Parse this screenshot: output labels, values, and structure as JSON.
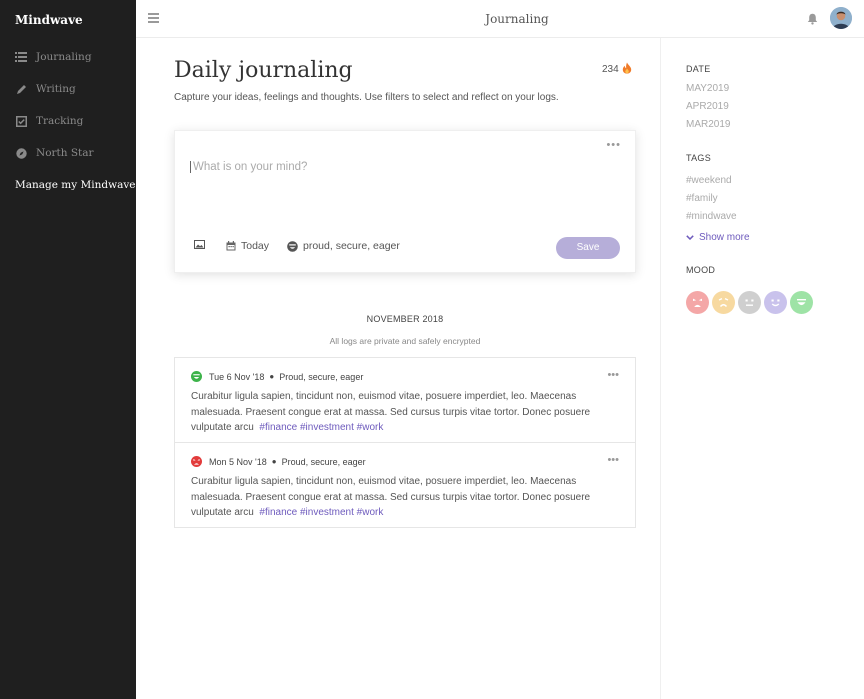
{
  "app": {
    "brand": "Mindwave",
    "window_title": "Journaling"
  },
  "sidebar": {
    "items": [
      {
        "label": "Journaling",
        "icon": "list-icon"
      },
      {
        "label": "Writing",
        "icon": "pen-icon"
      },
      {
        "label": "Tracking",
        "icon": "checkbox-icon"
      },
      {
        "label": "North Star",
        "icon": "compass-icon"
      }
    ],
    "manage_label": "Manage my Mindwave"
  },
  "header": {
    "title": "Daily journaling",
    "subtitle": "Capture your ideas, feelings and thoughts. Use filters to select and reflect on your logs.",
    "streak_count": "234",
    "streak_icon": "fire-icon"
  },
  "composer": {
    "placeholder": "What is on your mind?",
    "date_label": "Today",
    "mood_label": "proud, secure, eager",
    "save_label": "Save"
  },
  "feed": {
    "month_heading": "NOVEMBER 2018",
    "privacy_note": "All logs are private and safely encrypted",
    "entries": [
      {
        "date": "Tue 6 Nov '18",
        "mood_text": "Proud, secure, eager",
        "mood": "happy",
        "mood_color": "#3db34a",
        "text": "Curabitur ligula sapien, tincidunt non, euismod vitae, posuere imperdiet, leo. Maecenas malesuada. Praesent congue erat at massa. Sed cursus turpis vitae tortor. Donec posuere vulputate arcu",
        "tags": "#finance #investment #work"
      },
      {
        "date": "Mon 5 Nov '18",
        "mood_text": "Proud, secure, eager",
        "mood": "angry",
        "mood_color": "#e23b3b",
        "text": "Curabitur ligula sapien, tincidunt non, euismod vitae, posuere imperdiet, leo. Maecenas malesuada. Praesent congue erat at massa. Sed cursus turpis vitae tortor. Donec posuere vulputate arcu",
        "tags": "#finance #investment #work"
      }
    ]
  },
  "filters": {
    "date_heading": "DATE",
    "dates": [
      "MAY2019",
      "APR2019",
      "MAR2019"
    ],
    "tags_heading": "TAGS",
    "tags": [
      "#weekend",
      "#family",
      "#mindwave"
    ],
    "show_more_label": "Show more",
    "mood_heading": "MOOD",
    "moods": [
      {
        "name": "angry",
        "color": "#f4a7a7"
      },
      {
        "name": "sad",
        "color": "#f7d9a0"
      },
      {
        "name": "neutral",
        "color": "#cfcfcf"
      },
      {
        "name": "content",
        "color": "#c9c2ec"
      },
      {
        "name": "happy",
        "color": "#9ee3a6"
      }
    ]
  },
  "colors": {
    "accent": "#6e5bbd",
    "save_button": "#b6aed9",
    "sidebar_bg": "#1f1f1f"
  }
}
